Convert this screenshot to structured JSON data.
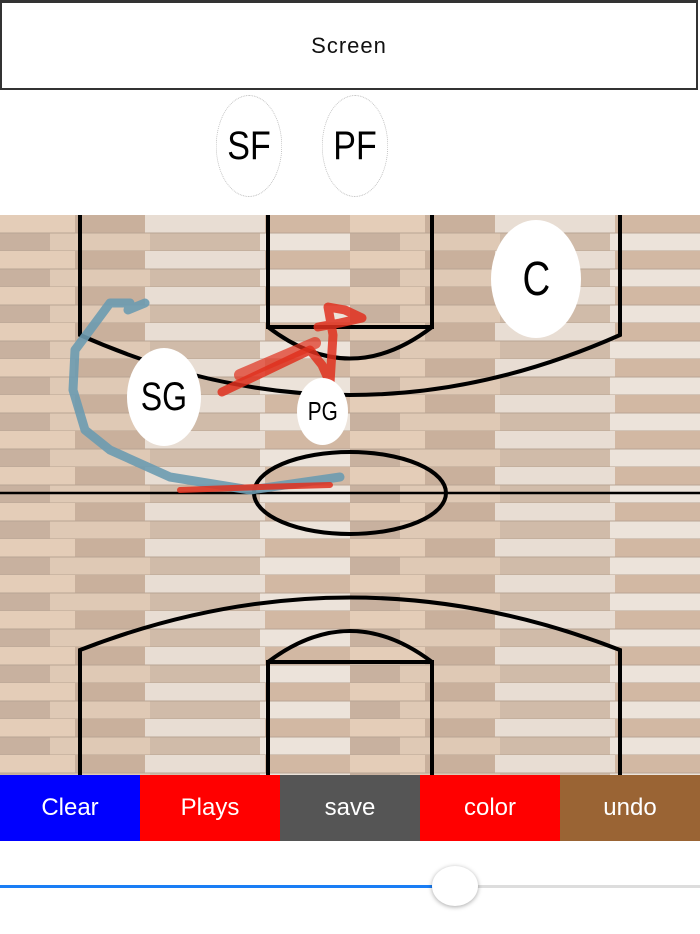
{
  "header": {
    "title": "Screen"
  },
  "bench": [
    {
      "label": "SF"
    },
    {
      "label": "PF"
    }
  ],
  "court": {
    "players": [
      {
        "label": "C"
      },
      {
        "label": "SG"
      },
      {
        "label": "PG"
      }
    ],
    "stroke_colors": {
      "blue": "#6c9bb0",
      "red": "#e0301e"
    }
  },
  "toolbar": {
    "buttons": [
      {
        "label": "Clear",
        "color": "#0000ff"
      },
      {
        "label": "Plays",
        "color": "#ff0000"
      },
      {
        "label": "save",
        "color": "#555555"
      },
      {
        "label": "color",
        "color": "#ff0000"
      },
      {
        "label": "undo",
        "color": "#9a6434"
      }
    ]
  },
  "slider": {
    "value": 0.65
  }
}
